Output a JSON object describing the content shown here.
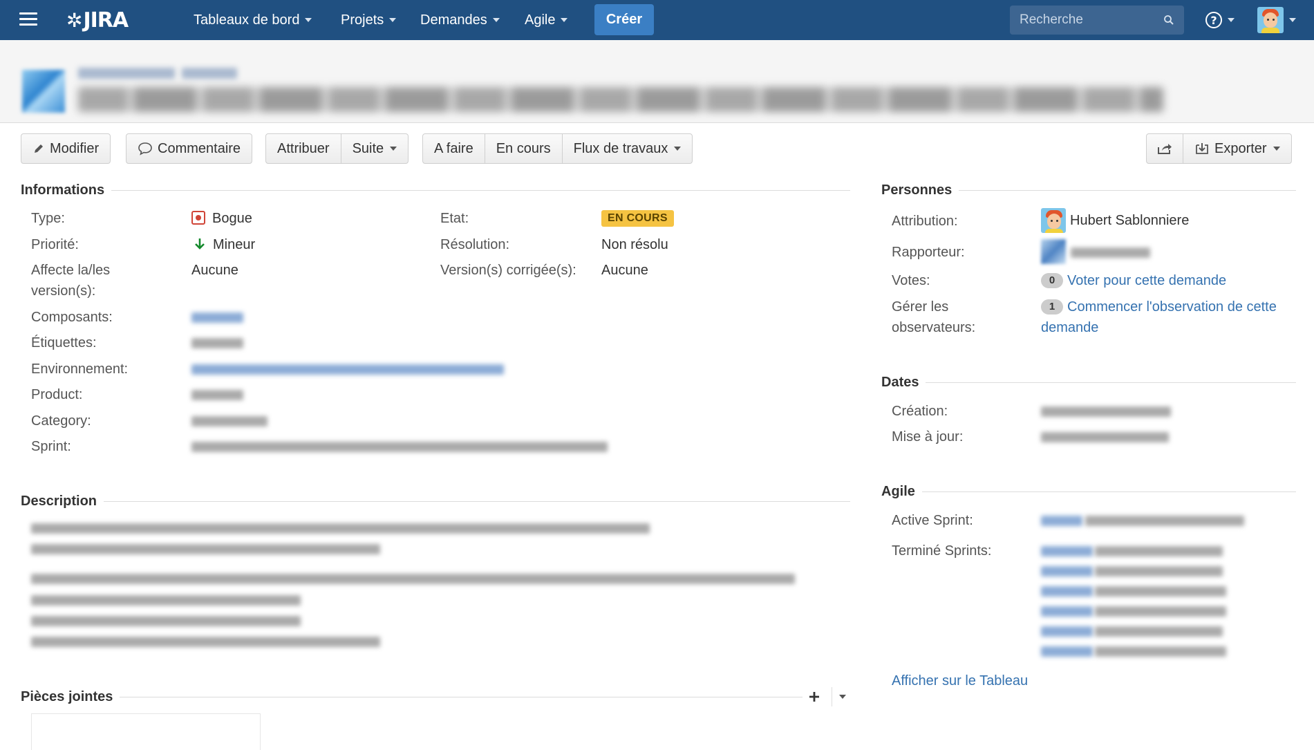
{
  "topnav": {
    "logo_text": "JIRA",
    "menus": [
      "Tableaux de bord",
      "Projets",
      "Demandes",
      "Agile"
    ],
    "create_label": "Créer",
    "search_placeholder": "Recherche",
    "help_symbol": "?",
    "colors": {
      "bar": "#205081",
      "create": "#3b7fc4"
    }
  },
  "toolbar": {
    "edit_label": "Modifier",
    "comment_label": "Commentaire",
    "assign_label": "Attribuer",
    "more_label": "Suite",
    "todo_label": "A faire",
    "inprogress_label": "En cours",
    "workflow_label": "Flux de travaux",
    "export_label": "Exporter"
  },
  "details": {
    "heading": "Informations",
    "type_label": "Type:",
    "type_value": "Bogue",
    "priority_label": "Priorité:",
    "priority_value": "Mineur",
    "affects_label_1": "Affecte la/les",
    "affects_label_2": "version(s):",
    "affects_value": "Aucune",
    "components_label": "Composants:",
    "labels_label": "Étiquettes:",
    "environment_label": "Environnement:",
    "product_label": "Product:",
    "category_label": "Category:",
    "sprint_label": "Sprint:",
    "status_label": "Etat:",
    "status_value": "EN COURS",
    "resolution_label": "Résolution:",
    "resolution_value": "Non résolu",
    "fixversion_label": "Version(s) corrigée(s):",
    "fixversion_value": "Aucune",
    "status_color": "#f5c342"
  },
  "description": {
    "heading": "Description"
  },
  "attachments": {
    "heading": "Pièces jointes"
  },
  "people": {
    "heading": "Personnes",
    "assignee_label": "Attribution:",
    "assignee_name": "Hubert Sablonniere",
    "reporter_label": "Rapporteur:",
    "votes_label": "Votes:",
    "votes_count": "0",
    "votes_link": "Voter pour cette demande",
    "watchers_label_1": "Gérer les",
    "watchers_label_2": "observateurs:",
    "watchers_count": "1",
    "watchers_link_1": "Commencer l'observation de cette",
    "watchers_link_2": "demande"
  },
  "dates": {
    "heading": "Dates",
    "created_label": "Création:",
    "updated_label": "Mise à jour:"
  },
  "agile": {
    "heading": "Agile",
    "active_sprint_label": "Active Sprint:",
    "completed_sprints_label": "Terminé Sprints:",
    "board_link": "Afficher sur le Tableau"
  }
}
